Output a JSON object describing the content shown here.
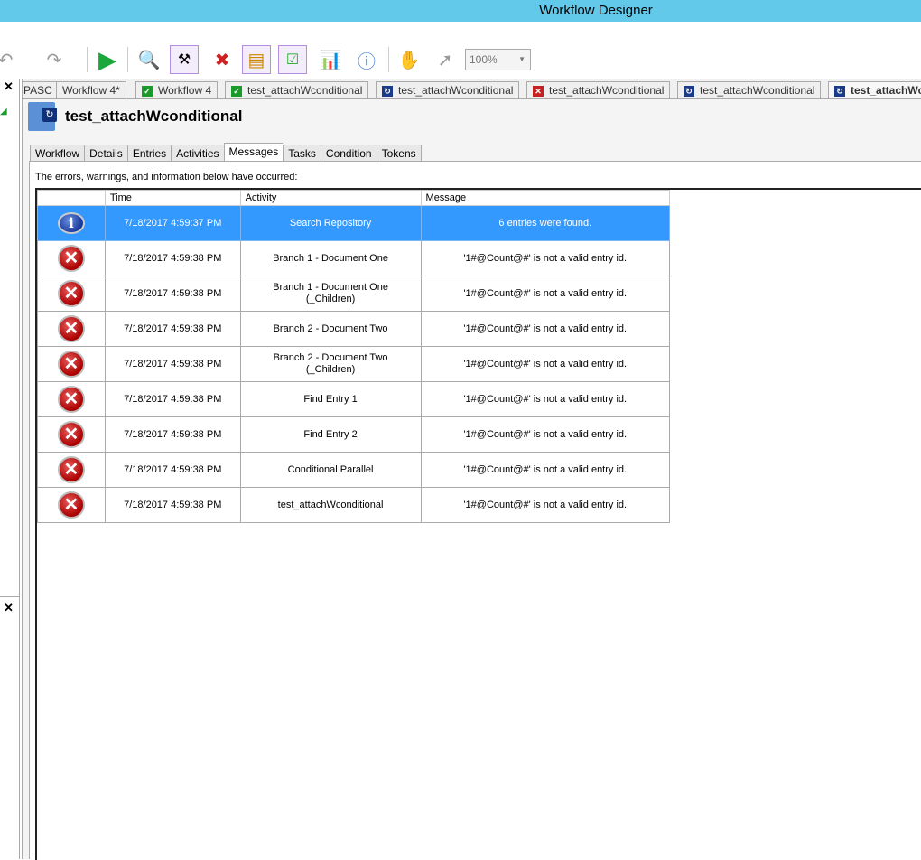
{
  "window": {
    "title": "Workflow Designer"
  },
  "toolbar": {
    "zoom": "100%",
    "buttons": [
      "undo",
      "redo",
      "run",
      "find",
      "tools",
      "stop",
      "layout",
      "checklist",
      "report",
      "info",
      "pan",
      "pointer"
    ]
  },
  "doc_tabs": [
    {
      "label": "PASC",
      "status": ""
    },
    {
      "label": "Workflow 4*",
      "status": ""
    },
    {
      "label": "Workflow 4",
      "status": "ok"
    },
    {
      "label": "test_attachWconditional",
      "status": "ok"
    },
    {
      "label": "test_attachWconditional",
      "status": "running"
    },
    {
      "label": "test_attachWconditional",
      "status": "error"
    },
    {
      "label": "test_attachWconditional",
      "status": "running"
    },
    {
      "label": "test_attachWconditional",
      "status": "running",
      "active": true
    }
  ],
  "header": {
    "title": "test_attachWconditional"
  },
  "sub_tabs": [
    "Workflow",
    "Details",
    "Entries",
    "Activities",
    "Messages",
    "Tasks",
    "Condition",
    "Tokens"
  ],
  "active_sub_tab": "Messages",
  "messages": {
    "intro": "The errors, warnings, and information below have occurred:",
    "columns": [
      "",
      "Time",
      "Activity",
      "Message"
    ],
    "rows": [
      {
        "type": "info",
        "time": "7/18/2017 4:59:37 PM",
        "activity": "Search Repository",
        "message": "6 entries were found."
      },
      {
        "type": "error",
        "time": "7/18/2017 4:59:38 PM",
        "activity": "Branch 1 - Document One",
        "message": "'1#@Count@#' is not a valid entry id."
      },
      {
        "type": "error",
        "time": "7/18/2017 4:59:38 PM",
        "activity": "Branch 1 - Document One (_Children)",
        "message": "'1#@Count@#' is not a valid entry id."
      },
      {
        "type": "error",
        "time": "7/18/2017 4:59:38 PM",
        "activity": "Branch 2 - Document Two",
        "message": "'1#@Count@#' is not a valid entry id."
      },
      {
        "type": "error",
        "time": "7/18/2017 4:59:38 PM",
        "activity": "Branch 2 - Document Two (_Children)",
        "message": "'1#@Count@#' is not a valid entry id."
      },
      {
        "type": "error",
        "time": "7/18/2017 4:59:38 PM",
        "activity": "Find Entry 1",
        "message": "'1#@Count@#' is not a valid entry id."
      },
      {
        "type": "error",
        "time": "7/18/2017 4:59:38 PM",
        "activity": "Find Entry 2",
        "message": "'1#@Count@#' is not a valid entry id."
      },
      {
        "type": "error",
        "time": "7/18/2017 4:59:38 PM",
        "activity": "Conditional Parallel",
        "message": "'1#@Count@#' is not a valid entry id."
      },
      {
        "type": "error",
        "time": "7/18/2017 4:59:38 PM",
        "activity": "test_attachWconditional",
        "message": "'1#@Count@#' is not a valid entry id."
      }
    ]
  },
  "colors": {
    "titlebar": "#62c9ea",
    "selected_row": "#3399ff"
  }
}
